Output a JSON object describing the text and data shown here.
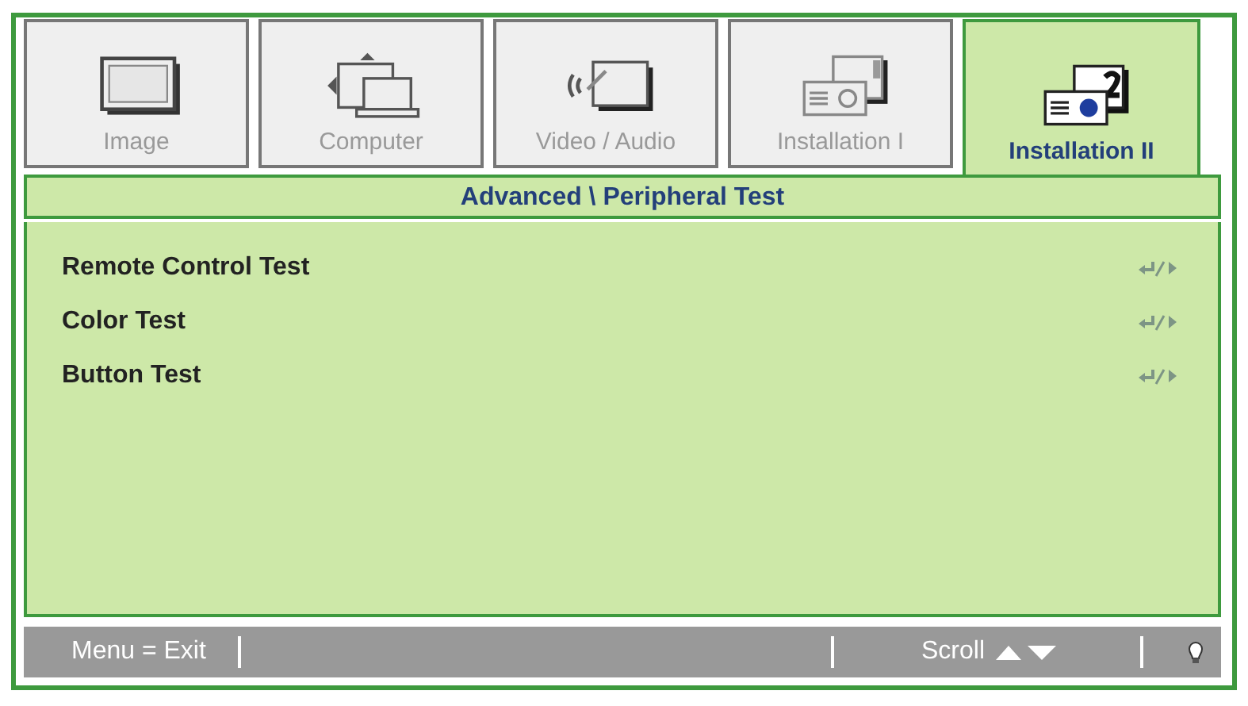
{
  "tabs": [
    {
      "label": "Image",
      "kind": "monitor",
      "selected": false
    },
    {
      "label": "Computer",
      "kind": "computer",
      "selected": false
    },
    {
      "label": "Video / Audio",
      "kind": "video",
      "selected": false
    },
    {
      "label": "Installation I",
      "kind": "projector1",
      "selected": false
    },
    {
      "label": "Installation II",
      "kind": "projector2",
      "selected": true
    }
  ],
  "breadcrumb": "Advanced \\ Peripheral Test",
  "items": [
    {
      "label": "Remote Control Test"
    },
    {
      "label": "Color Test"
    },
    {
      "label": "Button Test"
    }
  ],
  "status_bar": {
    "exit_hint": "Menu = Exit",
    "scroll_hint": "Scroll"
  }
}
